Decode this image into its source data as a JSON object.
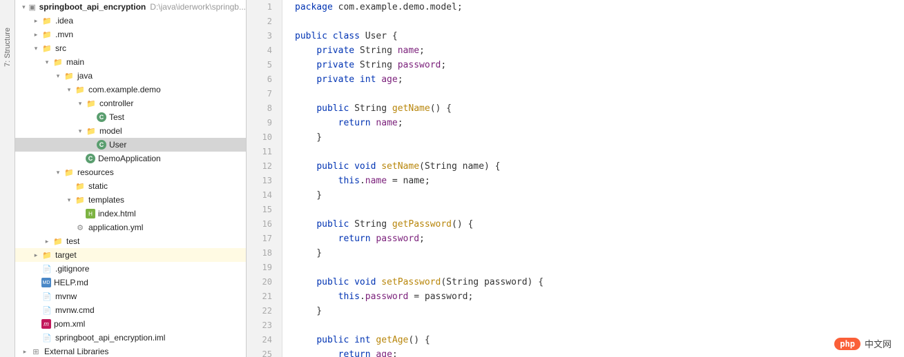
{
  "sideTab": {
    "structure": "7: Structure"
  },
  "tree": [
    {
      "indent": 0,
      "arrow": "down",
      "icon": "proj",
      "label": "springboot_api_encryption",
      "bold": true,
      "path": "D:\\java\\iderwork\\springb..."
    },
    {
      "indent": 1,
      "arrow": "right",
      "icon": "folder",
      "label": ".idea"
    },
    {
      "indent": 1,
      "arrow": "right",
      "icon": "folder",
      "label": ".mvn"
    },
    {
      "indent": 1,
      "arrow": "down",
      "icon": "folder-blue",
      "label": "src"
    },
    {
      "indent": 2,
      "arrow": "down",
      "icon": "folder-blue",
      "label": "main"
    },
    {
      "indent": 3,
      "arrow": "down",
      "icon": "folder-blue",
      "label": "java"
    },
    {
      "indent": 4,
      "arrow": "down",
      "icon": "folder",
      "label": "com.example.demo"
    },
    {
      "indent": 5,
      "arrow": "down",
      "icon": "folder",
      "label": "controller"
    },
    {
      "indent": 6,
      "arrow": "",
      "icon": "class",
      "label": "Test"
    },
    {
      "indent": 5,
      "arrow": "down",
      "icon": "folder",
      "label": "model"
    },
    {
      "indent": 6,
      "arrow": "",
      "icon": "class",
      "label": "User",
      "selected": true
    },
    {
      "indent": 5,
      "arrow": "",
      "icon": "class",
      "label": "DemoApplication"
    },
    {
      "indent": 3,
      "arrow": "down",
      "icon": "folder",
      "label": "resources"
    },
    {
      "indent": 4,
      "arrow": "",
      "icon": "folder",
      "label": "static"
    },
    {
      "indent": 4,
      "arrow": "down",
      "icon": "folder",
      "label": "templates"
    },
    {
      "indent": 5,
      "arrow": "",
      "icon": "html",
      "label": "index.html"
    },
    {
      "indent": 4,
      "arrow": "",
      "icon": "yml",
      "label": "application.yml"
    },
    {
      "indent": 2,
      "arrow": "right",
      "icon": "folder",
      "label": "test"
    },
    {
      "indent": 1,
      "arrow": "right",
      "icon": "folder-orange",
      "label": "target",
      "highlighted": true
    },
    {
      "indent": 1,
      "arrow": "",
      "icon": "file",
      "label": ".gitignore"
    },
    {
      "indent": 1,
      "arrow": "",
      "icon": "md",
      "label": "HELP.md"
    },
    {
      "indent": 1,
      "arrow": "",
      "icon": "file",
      "label": "mvnw"
    },
    {
      "indent": 1,
      "arrow": "",
      "icon": "file",
      "label": "mvnw.cmd"
    },
    {
      "indent": 1,
      "arrow": "",
      "icon": "m",
      "label": "pom.xml"
    },
    {
      "indent": 1,
      "arrow": "",
      "icon": "file",
      "label": "springboot_api_encryption.iml"
    },
    {
      "indent": 0,
      "arrow": "right",
      "icon": "lib",
      "label": "External Libraries"
    }
  ],
  "code": {
    "lines": [
      {
        "n": 1,
        "tokens": [
          [
            "kw",
            "package"
          ],
          [
            "",
            " "
          ],
          [
            "pkg",
            "com.example.demo.model"
          ],
          [
            "",
            ";"
          ]
        ]
      },
      {
        "n": 2,
        "tokens": []
      },
      {
        "n": 3,
        "tokens": [
          [
            "kw",
            "public class"
          ],
          [
            "",
            " User {"
          ]
        ]
      },
      {
        "n": 4,
        "tokens": [
          [
            "",
            "    "
          ],
          [
            "kw",
            "private"
          ],
          [
            "",
            " String "
          ],
          [
            "ident",
            "name"
          ],
          [
            "",
            ";"
          ]
        ]
      },
      {
        "n": 5,
        "tokens": [
          [
            "",
            "    "
          ],
          [
            "kw",
            "private"
          ],
          [
            "",
            " String "
          ],
          [
            "ident",
            "password"
          ],
          [
            "",
            ";"
          ]
        ]
      },
      {
        "n": 6,
        "tokens": [
          [
            "",
            "    "
          ],
          [
            "kw",
            "private int"
          ],
          [
            "",
            " "
          ],
          [
            "ident",
            "age"
          ],
          [
            "",
            ";"
          ]
        ]
      },
      {
        "n": 7,
        "tokens": []
      },
      {
        "n": 8,
        "tokens": [
          [
            "",
            "    "
          ],
          [
            "kw",
            "public"
          ],
          [
            "",
            " String "
          ],
          [
            "method",
            "getName"
          ],
          [
            "",
            "() {"
          ]
        ]
      },
      {
        "n": 9,
        "tokens": [
          [
            "",
            "        "
          ],
          [
            "kw",
            "return"
          ],
          [
            "",
            " "
          ],
          [
            "ident",
            "name"
          ],
          [
            "",
            ";"
          ]
        ]
      },
      {
        "n": 10,
        "tokens": [
          [
            "",
            "    }"
          ]
        ]
      },
      {
        "n": 11,
        "tokens": []
      },
      {
        "n": 12,
        "tokens": [
          [
            "",
            "    "
          ],
          [
            "kw",
            "public void"
          ],
          [
            "",
            " "
          ],
          [
            "method",
            "setName"
          ],
          [
            "",
            "(String name) {"
          ]
        ]
      },
      {
        "n": 13,
        "tokens": [
          [
            "",
            "        "
          ],
          [
            "kw",
            "this"
          ],
          [
            "",
            "."
          ],
          [
            "ident",
            "name"
          ],
          [
            "",
            " = name;"
          ]
        ]
      },
      {
        "n": 14,
        "tokens": [
          [
            "",
            "    }"
          ]
        ]
      },
      {
        "n": 15,
        "tokens": []
      },
      {
        "n": 16,
        "tokens": [
          [
            "",
            "    "
          ],
          [
            "kw",
            "public"
          ],
          [
            "",
            " String "
          ],
          [
            "method",
            "getPassword"
          ],
          [
            "",
            "() {"
          ]
        ]
      },
      {
        "n": 17,
        "tokens": [
          [
            "",
            "        "
          ],
          [
            "kw",
            "return"
          ],
          [
            "",
            " "
          ],
          [
            "ident",
            "password"
          ],
          [
            "",
            ";"
          ]
        ]
      },
      {
        "n": 18,
        "tokens": [
          [
            "",
            "    }"
          ]
        ]
      },
      {
        "n": 19,
        "tokens": []
      },
      {
        "n": 20,
        "tokens": [
          [
            "",
            "    "
          ],
          [
            "kw",
            "public void"
          ],
          [
            "",
            " "
          ],
          [
            "method",
            "setPassword"
          ],
          [
            "",
            "(String password) {"
          ]
        ]
      },
      {
        "n": 21,
        "tokens": [
          [
            "",
            "        "
          ],
          [
            "kw",
            "this"
          ],
          [
            "",
            "."
          ],
          [
            "ident",
            "password"
          ],
          [
            "",
            " = password;"
          ]
        ]
      },
      {
        "n": 22,
        "tokens": [
          [
            "",
            "    }"
          ]
        ]
      },
      {
        "n": 23,
        "tokens": []
      },
      {
        "n": 24,
        "tokens": [
          [
            "",
            "    "
          ],
          [
            "kw",
            "public int"
          ],
          [
            "",
            " "
          ],
          [
            "method",
            "getAge"
          ],
          [
            "",
            "() {"
          ]
        ]
      },
      {
        "n": 25,
        "tokens": [
          [
            "",
            "        "
          ],
          [
            "kw",
            "return"
          ],
          [
            "",
            " "
          ],
          [
            "ident",
            "age"
          ],
          [
            "",
            ";"
          ]
        ]
      }
    ]
  },
  "watermark": {
    "badge": "php",
    "text": "中文网"
  }
}
